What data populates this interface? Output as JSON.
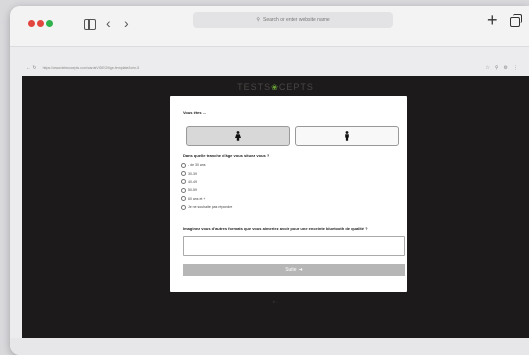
{
  "browser": {
    "address_placeholder": "Search or enter website name",
    "url": "https://www.tetesxcepts.com/cardsVIDEO/fige-femplate/lorin-5"
  },
  "site": {
    "logo_left": "TESTS",
    "logo_right": "CEPTS",
    "footer": "© ..."
  },
  "survey": {
    "q1": "Vous êtes ...",
    "genders": [
      "female",
      "male"
    ],
    "q2": "Dans quelle tranche d'âge vous situez vous ?",
    "age_options": [
      "- de 30 ans",
      "30-39",
      "40-49",
      "50-59",
      "60 ans et +",
      "Je ne souhaite pas répondre"
    ],
    "q3": "Imaginez vous d'autres formats que vous aimeriez avoir pour une enceinte bluetooth de qualité ?",
    "submit_label": "Suite"
  },
  "colors": {
    "site_bg": "#1c1a1a",
    "logo_accent": "#6aa23a",
    "submit_bg": "#b6b6b6"
  }
}
